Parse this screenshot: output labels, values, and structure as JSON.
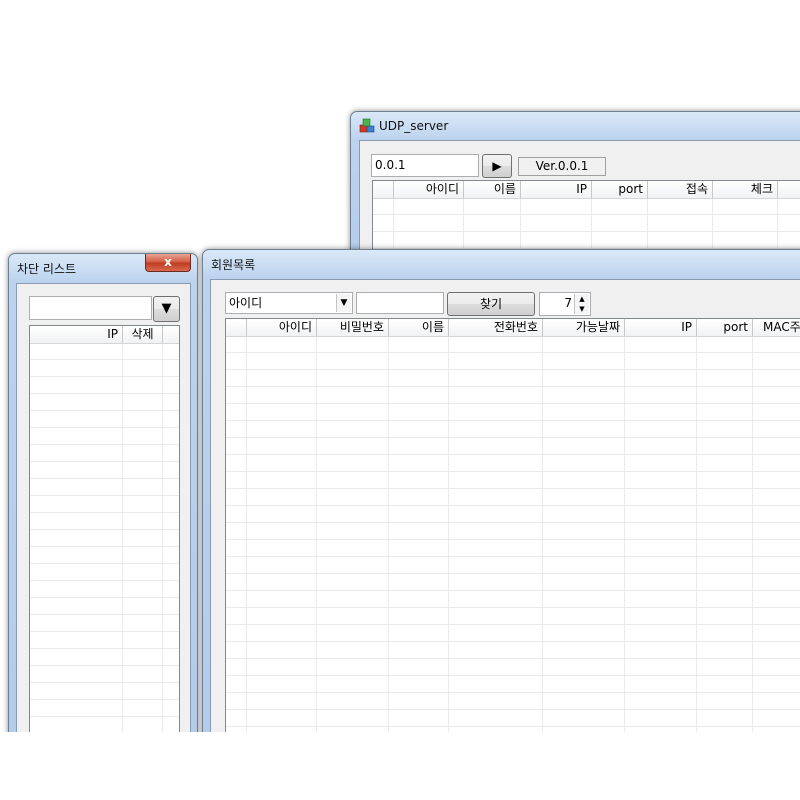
{
  "udp_window": {
    "title": "UDP_server",
    "ip_value": "0.0.1",
    "play_label": "▶",
    "version": "Ver.0.0.1",
    "columns": [
      "",
      "아이디",
      "이름",
      "IP",
      "port",
      "접속",
      "체크"
    ]
  },
  "block_window": {
    "title": "차단 리스트",
    "close_label": "x",
    "dropdown_arrow": "▼",
    "columns": [
      "IP",
      "삭제"
    ]
  },
  "member_window": {
    "title": "회원목록",
    "search_field": "아이디",
    "search_value": "",
    "find_label": "찾기",
    "spinner_value": "7",
    "columns": [
      "",
      "아이디",
      "비밀번호",
      "이름",
      "전화번호",
      "가능날짜",
      "IP",
      "port",
      "MAC주"
    ]
  },
  "icons": {
    "app": "app-cubes-icon",
    "close": "close-icon",
    "play": "play-icon",
    "dropdown": "chevron-down-icon",
    "spinner": "spinner-arrows-icon"
  }
}
